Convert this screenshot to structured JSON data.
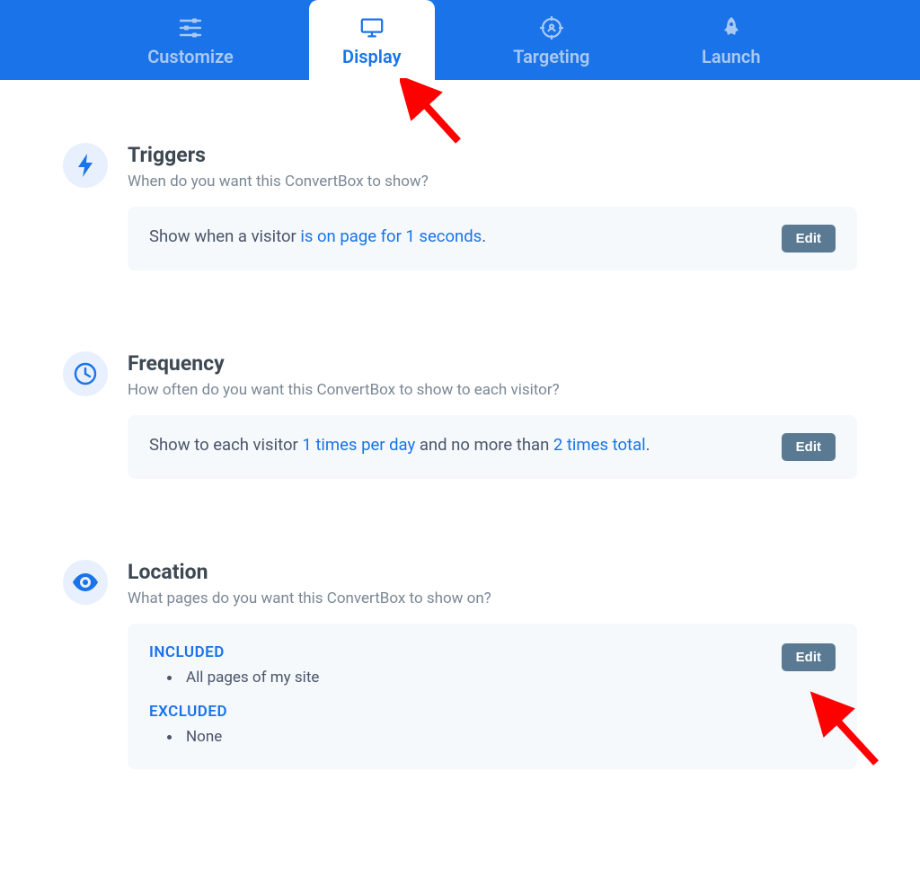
{
  "tabs": [
    {
      "label": "Customize",
      "active": false
    },
    {
      "label": "Display",
      "active": true
    },
    {
      "label": "Targeting",
      "active": false
    },
    {
      "label": "Launch",
      "active": false
    }
  ],
  "triggers": {
    "title": "Triggers",
    "subtitle": "When do you want this ConvertBox to show?",
    "rule_prefix": "Show when a visitor ",
    "rule_link": "is on page for 1 seconds",
    "rule_suffix": ".",
    "edit_label": "Edit"
  },
  "frequency": {
    "title": "Frequency",
    "subtitle": "How often do you want this ConvertBox to show to each visitor?",
    "rule_prefix": "Show to each visitor ",
    "rule_link1": "1 times per day",
    "rule_mid": " and no more than ",
    "rule_link2": "2 times total",
    "rule_suffix": ".",
    "edit_label": "Edit"
  },
  "location": {
    "title": "Location",
    "subtitle": "What pages do you want this ConvertBox to show on?",
    "included_label": "INCLUDED",
    "included_item": "All pages of my site",
    "excluded_label": "EXCLUDED",
    "excluded_item": "None",
    "edit_label": "Edit"
  }
}
